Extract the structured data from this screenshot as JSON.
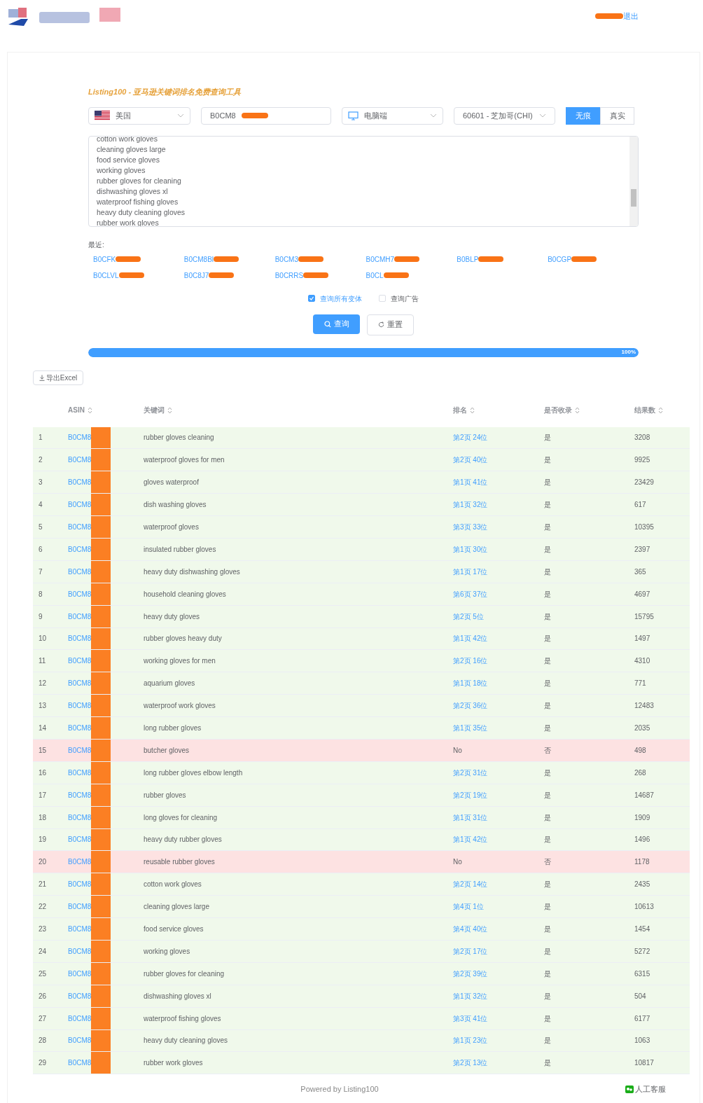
{
  "header": {
    "logout": "退出"
  },
  "title": "Listing100 - 亚马逊关键词排名免费查询工具",
  "filters": [
    {
      "kind": "country",
      "value": "美国"
    },
    {
      "kind": "asin",
      "value": "B0CM8"
    },
    {
      "kind": "device",
      "value": "电脑端"
    },
    {
      "kind": "zip",
      "value": "60601 - 芝加哥(CHI)"
    }
  ],
  "mode_toggle": [
    {
      "label": "无痕",
      "selected": true
    },
    {
      "label": "真实",
      "selected": false
    }
  ],
  "keywords": [
    "cotton work gloves",
    "cleaning gloves large",
    "food service gloves",
    "working gloves",
    "rubber gloves for cleaning",
    "dishwashing gloves xl",
    "waterproof fishing gloves",
    "heavy duty cleaning gloves",
    "rubber work gloves"
  ],
  "recent": {
    "label": "最近:",
    "items": [
      "B0CFK",
      "B0CM8Bl",
      "B0CM3",
      "B0CMH7",
      "B0BLP",
      "B0CGP",
      "B0CLVL",
      "B0C8J7",
      "B0CRRS",
      "B0CL"
    ]
  },
  "options": [
    {
      "label": "查询所有变体",
      "checked": true
    },
    {
      "label": "查询广告",
      "checked": false
    }
  ],
  "query_button": "查询",
  "reset_button": "重置",
  "progress": {
    "level": 1,
    "reading": "100%"
  },
  "export_button": "导出Excel",
  "table": {
    "columns": [
      "ASIN",
      "关键词",
      "排名",
      "是否收录",
      "结果数"
    ],
    "rows": [
      {
        "index": "1",
        "asin": "B0CM8",
        "keyword": "rubber gloves cleaning",
        "rank": "第2页 24位",
        "indexed": "是",
        "results": "3208",
        "matched": true
      },
      {
        "index": "2",
        "asin": "B0CM8",
        "keyword": "waterproof gloves for men",
        "rank": "第2页 40位",
        "indexed": "是",
        "results": "9925",
        "matched": true
      },
      {
        "index": "3",
        "asin": "B0CM8",
        "keyword": "gloves waterproof",
        "rank": "第1页 41位",
        "indexed": "是",
        "results": "23429",
        "matched": true
      },
      {
        "index": "4",
        "asin": "B0CM8",
        "keyword": "dish washing gloves",
        "rank": "第1页 32位",
        "indexed": "是",
        "results": "617",
        "matched": true
      },
      {
        "index": "5",
        "asin": "B0CM8",
        "keyword": "waterproof gloves",
        "rank": "第3页 33位",
        "indexed": "是",
        "results": "10395",
        "matched": true
      },
      {
        "index": "6",
        "asin": "B0CM8",
        "keyword": "insulated rubber gloves",
        "rank": "第1页 30位",
        "indexed": "是",
        "results": "2397",
        "matched": true
      },
      {
        "index": "7",
        "asin": "B0CM8",
        "keyword": "heavy duty dishwashing gloves",
        "rank": "第1页 17位",
        "indexed": "是",
        "results": "365",
        "matched": true
      },
      {
        "index": "8",
        "asin": "B0CM8",
        "keyword": "household cleaning gloves",
        "rank": "第6页 37位",
        "indexed": "是",
        "results": "4697",
        "matched": true
      },
      {
        "index": "9",
        "asin": "B0CM8",
        "keyword": "heavy duty gloves",
        "rank": "第2页 5位",
        "indexed": "是",
        "results": "15795",
        "matched": true
      },
      {
        "index": "10",
        "asin": "B0CM8",
        "keyword": "rubber gloves heavy duty",
        "rank": "第1页 42位",
        "indexed": "是",
        "results": "1497",
        "matched": true
      },
      {
        "index": "11",
        "asin": "B0CM8",
        "keyword": "working gloves for men",
        "rank": "第2页 16位",
        "indexed": "是",
        "results": "4310",
        "matched": true
      },
      {
        "index": "12",
        "asin": "B0CM8",
        "keyword": "aquarium gloves",
        "rank": "第1页 18位",
        "indexed": "是",
        "results": "771",
        "matched": true
      },
      {
        "index": "13",
        "asin": "B0CM8",
        "keyword": "waterproof work gloves",
        "rank": "第2页 36位",
        "indexed": "是",
        "results": "12483",
        "matched": true
      },
      {
        "index": "14",
        "asin": "B0CM8",
        "keyword": "long rubber gloves",
        "rank": "第1页 35位",
        "indexed": "是",
        "results": "2035",
        "matched": true
      },
      {
        "index": "15",
        "asin": "B0CM8",
        "keyword": "butcher gloves",
        "rank": "No",
        "indexed": "否",
        "results": "498",
        "matched": false
      },
      {
        "index": "16",
        "asin": "B0CM8",
        "keyword": "long rubber gloves elbow length",
        "rank": "第2页 31位",
        "indexed": "是",
        "results": "268",
        "matched": true
      },
      {
        "index": "17",
        "asin": "B0CM8",
        "keyword": "rubber gloves",
        "rank": "第2页 19位",
        "indexed": "是",
        "results": "14687",
        "matched": true
      },
      {
        "index": "18",
        "asin": "B0CM8",
        "keyword": "long gloves for cleaning",
        "rank": "第1页 31位",
        "indexed": "是",
        "results": "1909",
        "matched": true
      },
      {
        "index": "19",
        "asin": "B0CM8",
        "keyword": "heavy duty rubber gloves",
        "rank": "第1页 42位",
        "indexed": "是",
        "results": "1496",
        "matched": true
      },
      {
        "index": "20",
        "asin": "B0CM8",
        "keyword": "reusable rubber gloves",
        "rank": "No",
        "indexed": "否",
        "results": "1178",
        "matched": false
      },
      {
        "index": "21",
        "asin": "B0CM8",
        "keyword": "cotton work gloves",
        "rank": "第2页 14位",
        "indexed": "是",
        "results": "2435",
        "matched": true
      },
      {
        "index": "22",
        "asin": "B0CM8",
        "keyword": "cleaning gloves large",
        "rank": "第4页 1位",
        "indexed": "是",
        "results": "10613",
        "matched": true
      },
      {
        "index": "23",
        "asin": "B0CM8",
        "keyword": "food service gloves",
        "rank": "第4页 40位",
        "indexed": "是",
        "results": "1454",
        "matched": true
      },
      {
        "index": "24",
        "asin": "B0CM8",
        "keyword": "working gloves",
        "rank": "第2页 17位",
        "indexed": "是",
        "results": "5272",
        "matched": true
      },
      {
        "index": "25",
        "asin": "B0CM8",
        "keyword": "rubber gloves for cleaning",
        "rank": "第2页 39位",
        "indexed": "是",
        "results": "6315",
        "matched": true
      },
      {
        "index": "26",
        "asin": "B0CM8",
        "keyword": "dishwashing gloves xl",
        "rank": "第1页 32位",
        "indexed": "是",
        "results": "504",
        "matched": true
      },
      {
        "index": "27",
        "asin": "B0CM8",
        "keyword": "waterproof fishing gloves",
        "rank": "第3页 41位",
        "indexed": "是",
        "results": "6177",
        "matched": true
      },
      {
        "index": "28",
        "asin": "B0CM8",
        "keyword": "heavy duty cleaning gloves",
        "rank": "第1页 23位",
        "indexed": "是",
        "results": "1063",
        "matched": true
      },
      {
        "index": "29",
        "asin": "B0CM8",
        "keyword": "rubber work gloves",
        "rank": "第2页 13位",
        "indexed": "是",
        "results": "10817",
        "matched": true
      }
    ]
  },
  "footer": {
    "powered": "Powered by Listing100",
    "support": "人工客服"
  }
}
